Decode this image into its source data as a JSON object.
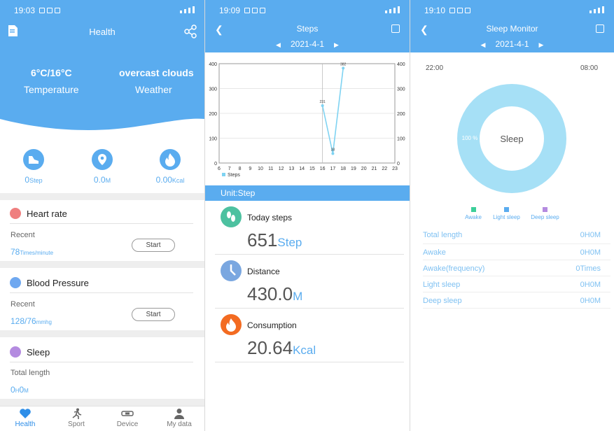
{
  "colors": {
    "accent": "#5aacef",
    "heart": "#ef7f7f",
    "bp": "#6fa8f0",
    "sleep": "#b48be0",
    "distance": "#7aa7e0",
    "fire": "#f36b21",
    "footprint": "#4dc1a0",
    "ring": "#a6e0f6",
    "awake": "#3ccf9a",
    "light_sleep": "#5aacef",
    "deep_sleep": "#b48be0"
  },
  "status_bars": [
    {
      "time": "19:03"
    },
    {
      "time": "19:09"
    },
    {
      "time": "19:10"
    }
  ],
  "health": {
    "title": "Health",
    "weather": {
      "temp_low_high": "6°C/16°C",
      "temp_label": "Temperature",
      "condition": "overcast clouds",
      "condition_label": "Weather"
    },
    "stats": [
      {
        "value": "0",
        "unit": "Step",
        "icon": "shoe-icon"
      },
      {
        "value": "0.0",
        "unit": "M",
        "icon": "location-icon"
      },
      {
        "value": "0.00",
        "unit": "Kcal",
        "icon": "flame-icon"
      }
    ],
    "heart_rate": {
      "title": "Heart rate",
      "recent_label": "Recent",
      "value": "78",
      "unit": "Times/minute",
      "start_label": "Start"
    },
    "blood_pressure": {
      "title": "Blood Pressure",
      "recent_label": "Recent",
      "value": "128/76",
      "unit": "mmhg",
      "start_label": "Start"
    },
    "sleep": {
      "title": "Sleep",
      "total_label": "Total length",
      "value_h": "0",
      "unit_h": "H",
      "value_m": "0",
      "unit_m": "M"
    }
  },
  "bottom_nav": [
    {
      "label": "Health",
      "icon": "heart-icon",
      "active": true
    },
    {
      "label": "Sport",
      "icon": "runner-icon",
      "active": false
    },
    {
      "label": "Device",
      "icon": "band-icon",
      "active": false
    },
    {
      "label": "My data",
      "icon": "person-icon",
      "active": false
    }
  ],
  "steps": {
    "title": "Steps",
    "date": "2021-4-1",
    "unit_bar": "Unit:Step",
    "metrics": [
      {
        "title": "Today steps",
        "value": "651",
        "unit": "Step",
        "icon": "footprint-icon"
      },
      {
        "title": "Distance",
        "value": "430.0",
        "unit": "M",
        "icon": "clock-icon"
      },
      {
        "title": "Consumption",
        "value": "20.64",
        "unit": "Kcal",
        "icon": "flame-icon"
      }
    ]
  },
  "chart_data": {
    "type": "line",
    "x": [
      16,
      17,
      18
    ],
    "series": [
      {
        "name": "Steps",
        "values": [
          231,
          38,
          382
        ]
      }
    ],
    "data_labels": [
      "231",
      "38",
      "382"
    ],
    "xticks": [
      "6",
      "7",
      "8",
      "9",
      "10",
      "11",
      "12",
      "13",
      "14",
      "15",
      "16",
      "17",
      "18",
      "19",
      "20",
      "21",
      "22",
      "23"
    ],
    "yticks_left": [
      "0",
      "100",
      "200",
      "300",
      "400"
    ],
    "yticks_right": [
      "0",
      "100",
      "200",
      "300",
      "400"
    ],
    "xlim": [
      6,
      23
    ],
    "ylim": [
      0,
      400
    ],
    "legend": "bottom-left",
    "grid": true
  },
  "sleep_monitor": {
    "title": "Sleep Monitor",
    "date": "2021-4-1",
    "start_time": "22:00",
    "end_time": "08:00",
    "center_label": "Sleep",
    "percent_label": "100 %",
    "legend": [
      "Awake",
      "Light sleep",
      "Deep sleep"
    ],
    "rows": [
      {
        "label": "Total length",
        "value": "0H0M"
      },
      {
        "label": "Awake",
        "value": "0H0M"
      },
      {
        "label": "Awake(frequency)",
        "value": "0Times"
      },
      {
        "label": "Light sleep",
        "value": "0H0M"
      },
      {
        "label": "Deep sleep",
        "value": "0H0M"
      }
    ]
  }
}
